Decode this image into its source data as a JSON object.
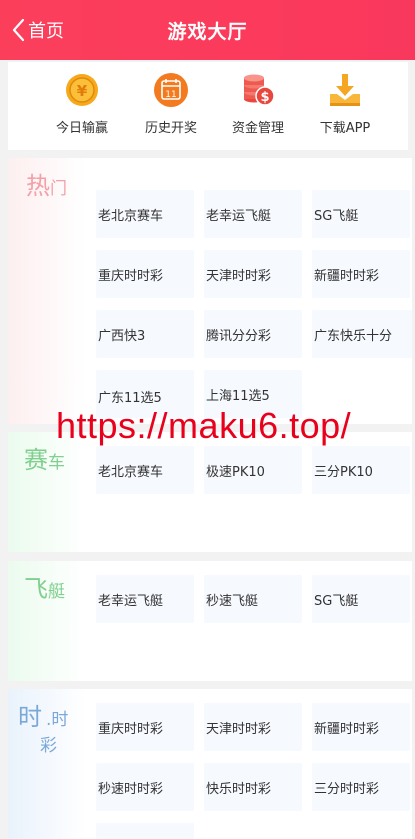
{
  "header": {
    "back_label": "首页",
    "title": "游戏大厅"
  },
  "quick_links": [
    {
      "label": "今日输赢",
      "icon": "coin-icon",
      "color": "#f39c12"
    },
    {
      "label": "历史开奖",
      "icon": "calendar-icon",
      "color": "#f0731e"
    },
    {
      "label": "资金管理",
      "icon": "money-stack-icon",
      "color": "#ef5a50"
    },
    {
      "label": "下载APP",
      "icon": "download-icon",
      "color": "#f5a623"
    }
  ],
  "sections": {
    "hot": {
      "title_big": "热",
      "title_small": "门",
      "color": "#f3a0a8",
      "games": [
        "老北京赛车",
        "老幸运飞艇",
        "SG飞艇",
        "重庆时时彩",
        "天津时时彩",
        "新疆时时彩",
        "广西快3",
        "腾讯分分彩",
        "广东快乐十分",
        "广东11选5",
        "上海11选5"
      ]
    },
    "racing": {
      "title_big": "赛",
      "title_small": "车",
      "color": "#7fd08e",
      "games": [
        "老北京赛车",
        "极速PK10",
        "三分PK10"
      ]
    },
    "boat": {
      "title_big": "飞",
      "title_small": "艇",
      "color": "#7fd08e",
      "games": [
        "老幸运飞艇",
        "秒速飞艇",
        "SG飞艇"
      ]
    },
    "ssc": {
      "title_big": "时",
      "title_dot": ".",
      "title_small": "时",
      "title_small2": "彩",
      "color": "#7aa8d8",
      "games": [
        "重庆时时彩",
        "天津时时彩",
        "新疆时时彩",
        "秒速时时彩",
        "快乐时时彩",
        "三分时时彩"
      ]
    }
  },
  "watermark": "https://maku6.top/"
}
